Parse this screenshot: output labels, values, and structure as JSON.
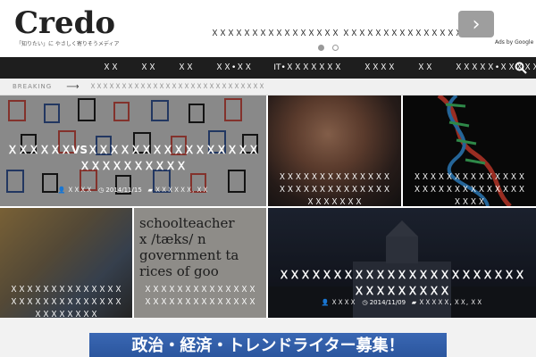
{
  "header": {
    "logo": "Credo",
    "tagline": "「知りたい」に やさしく寄りそうメディア"
  },
  "ad": {
    "text": "ＸＸＸＸＸＸＸＸＸＸＸＸＸＸＸＸ ＸＸＸＸＸＸＸＸＸＸＸＸＸＸＸＸＸＸ",
    "next_label": "›",
    "ads_by": "Ads by Google"
  },
  "nav": {
    "items": [
      "ＸＸ",
      "ＸＸ",
      "ＸＸ",
      "ＸＸ•ＸＸ",
      "IT•ＸＸＸＸＸＸＸ",
      "ＸＸＸＸ",
      "ＸＸ",
      "ＸＸＸＸＸ•ＸＸＸＸＸ"
    ]
  },
  "breaking": {
    "label": "BREAKING",
    "text": "ＸＸＸＸＸＸＸＸＸＸＸＸＸＸＸＸＸＸＸＸＸＸＸＸＸＸＸＸ"
  },
  "tiles": [
    {
      "title": "ＸＸＸＸＸＸVSＸＸＸＸＸＸＸＸＸＸＸＸＸＸＸＸＸＸＸＸＸＸＸＸＸＸ",
      "author": "ＸＸＸＸ",
      "date": "2014/11/15",
      "category": "ＸＸＸＸＸＸ, ＸＸ"
    },
    {
      "title": "ＸＸＸＸＸＸＸＸＸＸＸＸＸＸＸＸＸＸＸＸＸＸＸＸＸＸＸＸＸＸＸＸＸＸＸ"
    },
    {
      "title": "ＸＸＸＸＸＸＸＸＸＸＸＸＸＸＸＸＸＸＸＸＸＸＸＸＸＸＸＸＸＸＸＸ"
    },
    {
      "title": "ＸＸＸＸＸＸＸＸＸＸＸＸＸＸＸＸＸＸＸＸＸＸＸＸＸＸＸＸＸＸＸＸＸＸＸＸ"
    },
    {
      "title": "ＸＸＸＸＸＸＸＸＸＸＸＸＸＸＸＸＸＸＸＸＸＸＸＸＸＸＸＸ"
    },
    {
      "title": "ＸＸＸＸＸＸＸＸＸＸＸＸＸＸＸＸＸＸＸＸＸＸＸＸＸＸＸＸＸＸＸＸ",
      "author": "ＸＸＸＸ",
      "date": "2014/11/09",
      "category": "ＸＸＸＸＸ, ＸＸ, ＸＸ"
    }
  ],
  "banner": {
    "text": "政治・経済・トレンドライター募集！"
  },
  "colors": {
    "nav_bg": "#1e1e1e",
    "banner_bg": "#2f5ca6"
  }
}
